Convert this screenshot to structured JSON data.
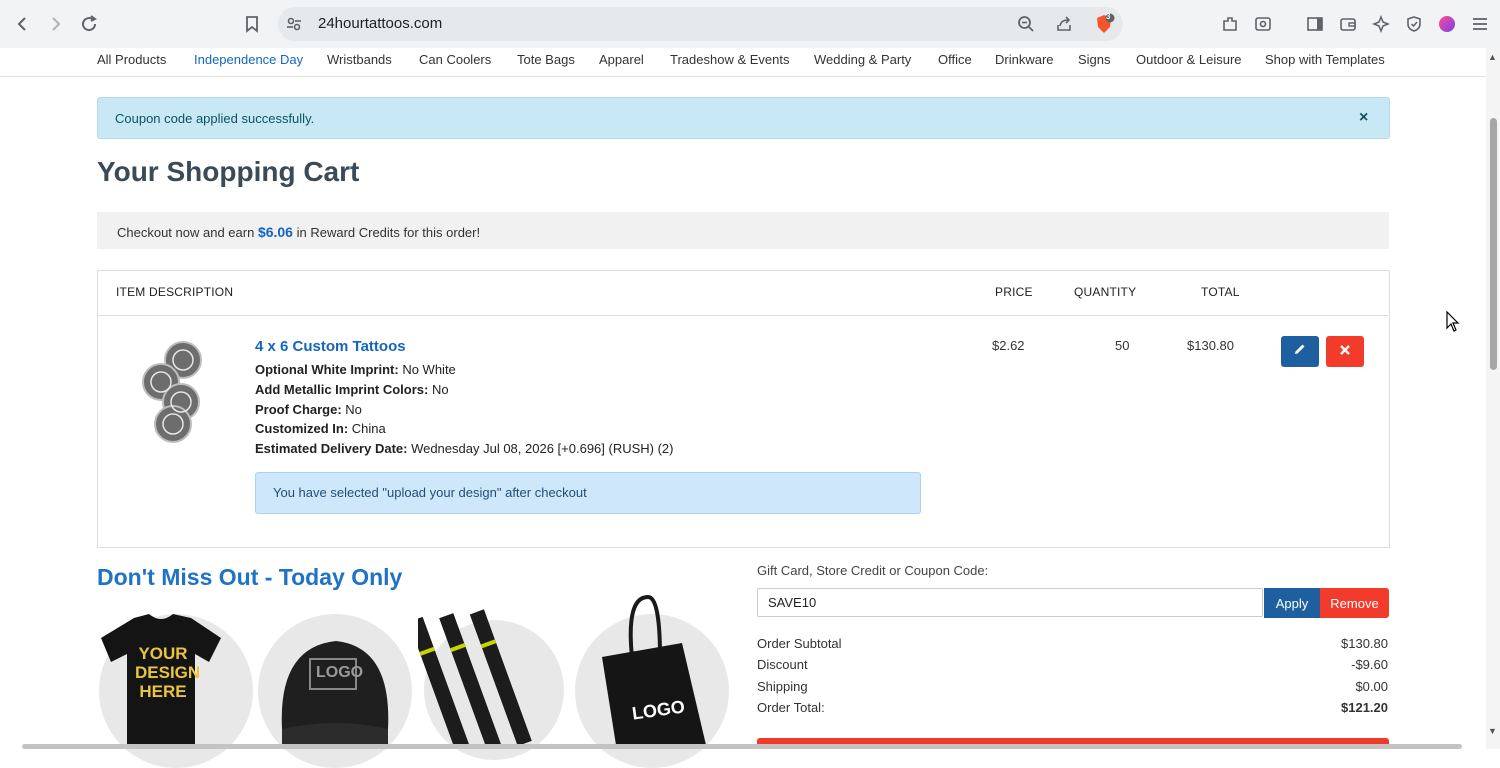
{
  "browser": {
    "url": "24hourtattoos.com",
    "shield_badge": "3"
  },
  "nav": {
    "items": [
      {
        "label": "All Products"
      },
      {
        "label": "Independence Day"
      },
      {
        "label": "Wristbands"
      },
      {
        "label": "Can Coolers"
      },
      {
        "label": "Tote Bags"
      },
      {
        "label": "Apparel"
      },
      {
        "label": "Tradeshow & Events"
      },
      {
        "label": "Wedding & Party"
      },
      {
        "label": "Office"
      },
      {
        "label": "Drinkware"
      },
      {
        "label": "Signs"
      },
      {
        "label": "Outdoor & Leisure"
      },
      {
        "label": "Shop with Templates"
      }
    ]
  },
  "alert": {
    "message": "Coupon code applied successfully.",
    "close": "×"
  },
  "cart": {
    "title": "Your Shopping Cart",
    "reward_prefix": "Checkout now and earn ",
    "reward_amount": "$6.06",
    "reward_suffix": " in Reward Credits for this order!",
    "columns": {
      "description": "ITEM DESCRIPTION",
      "price": "PRICE",
      "quantity": "QUANTITY",
      "total": "TOTAL"
    },
    "item": {
      "title": "4 x 6 Custom Tattoos",
      "attrs": [
        {
          "label": "Optional White Imprint:",
          "value": " No White"
        },
        {
          "label": "Add Metallic Imprint Colors:",
          "value": " No"
        },
        {
          "label": "Proof Charge:",
          "value": " No"
        },
        {
          "label": "Customized In:",
          "value": " China"
        },
        {
          "label": "Estimated Delivery Date:",
          "value": " Wednesday Jul 08, 2026 [+0.696] (RUSH) (2)"
        }
      ],
      "design_note": "You have selected \"upload your design\" after checkout",
      "price": "$2.62",
      "quantity": "50",
      "total": "$130.80"
    }
  },
  "promo": {
    "title": "Don't Miss Out - Today Only",
    "shirt_text": "YOUR DESIGN HERE",
    "logo_text": "LOGO"
  },
  "coupon": {
    "label": "Gift Card, Store Credit or Coupon Code:",
    "value": "SAVE10",
    "apply": "Apply",
    "remove": "Remove"
  },
  "summary": {
    "rows": [
      {
        "label": "Order Subtotal",
        "value": "$130.80"
      },
      {
        "label": "Discount",
        "value": "-$9.60"
      },
      {
        "label": "Shipping",
        "value": "$0.00"
      },
      {
        "label": "Order Total:",
        "value": "$121.20"
      }
    ]
  },
  "colors": {
    "accent_blue": "#1565c0",
    "danger_red": "#f33b2b",
    "alert_bg": "#c7e8f4"
  }
}
